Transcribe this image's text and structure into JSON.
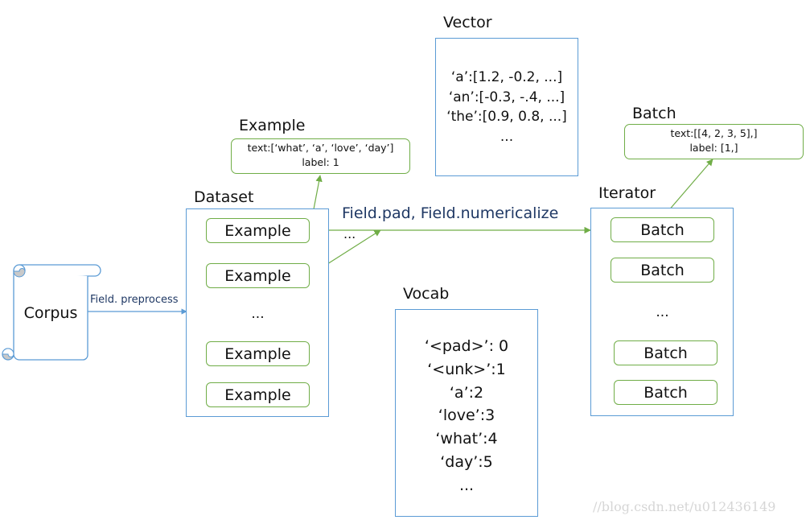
{
  "colors": {
    "container_border": "#5b9bd5",
    "item_border": "#70ad47",
    "arrow_green": "#70ad47",
    "arrow_blue": "#5b9bd5",
    "label_blue": "#1f3864",
    "scroll_fill": "#c9c9c9"
  },
  "corpus": {
    "label": "Corpus",
    "icon": "scroll-icon"
  },
  "preprocess_label": "Field. preprocess",
  "dataset": {
    "title": "Dataset",
    "items": [
      "Example",
      "Example",
      "Example",
      "Example"
    ],
    "ellipsis": "..."
  },
  "example_detail": {
    "title": "Example",
    "text_line": "text:[‘what’, ‘a’, ‘love’, ‘day’]",
    "label_line": "label: 1"
  },
  "vector": {
    "title": "Vector",
    "lines": [
      "‘a’:[1.2, -0.2, ...]",
      "‘an’:[-0.3, -.4, ...]",
      "‘the’:[0.9, 0.8, ...]",
      "..."
    ]
  },
  "numericalize_label": "Field.pad, Field.numericalize",
  "numericalize_ellipsis": "...",
  "vocab": {
    "title": "Vocab",
    "lines": [
      "‘<pad>’: 0",
      "‘<unk>’:1",
      "‘a’:2",
      "‘love’:3",
      "‘what’:4",
      "‘day’:5",
      "..."
    ]
  },
  "iterator": {
    "title": "Iterator",
    "items": [
      "Batch",
      "Batch",
      "Batch",
      "Batch"
    ],
    "ellipsis": "..."
  },
  "batch_detail": {
    "title": "Batch",
    "text_line": "text:[[4, 2, 3, 5],]",
    "label_line": "label: [1,]"
  },
  "watermark": "//blog.csdn.net/u012436149"
}
